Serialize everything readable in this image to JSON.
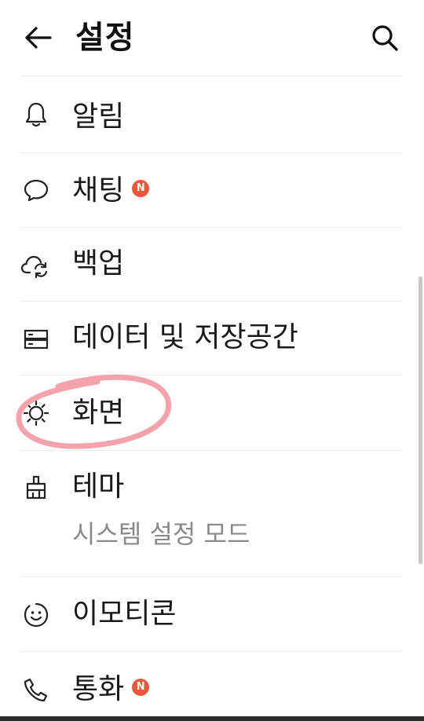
{
  "header": {
    "title": "설정",
    "back_icon": "arrow-left-icon",
    "search_icon": "search-icon"
  },
  "menu": [
    {
      "label": "알림",
      "icon": "bell-icon"
    },
    {
      "label": "채팅",
      "icon": "chat-bubble-icon",
      "badge": "N"
    },
    {
      "label": "백업",
      "icon": "cloud-sync-icon"
    },
    {
      "label": "데이터 및 저장공간",
      "icon": "storage-icon"
    },
    {
      "label": "화면",
      "icon": "brightness-icon"
    },
    {
      "label": "테마",
      "icon": "paint-brush-icon",
      "subtitle": "시스템 설정 모드"
    },
    {
      "label": "이모티콘",
      "icon": "smiley-icon"
    },
    {
      "label": "통화",
      "icon": "phone-icon",
      "badge": "N"
    }
  ],
  "colors": {
    "badge": "#e8593b",
    "highlight_circle": "#f4a3ad",
    "subtitle_text": "#8a8a8a"
  }
}
